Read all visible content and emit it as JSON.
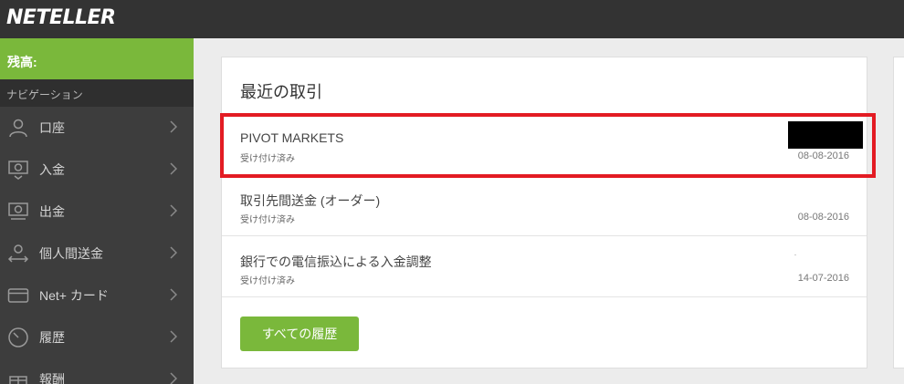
{
  "header": {
    "logo": "NETELLER"
  },
  "sidebar": {
    "balance_label": "残高:",
    "nav_header": "ナビゲーション",
    "items": [
      {
        "label": "口座",
        "icon": "user-icon"
      },
      {
        "label": "入金",
        "icon": "deposit-icon"
      },
      {
        "label": "出金",
        "icon": "withdraw-icon"
      },
      {
        "label": "個人間送金",
        "icon": "transfer-icon"
      },
      {
        "label": "Net+ カード",
        "icon": "card-icon"
      },
      {
        "label": "履歴",
        "icon": "history-icon"
      },
      {
        "label": "報酬",
        "icon": "gift-icon"
      }
    ]
  },
  "recent": {
    "title": "最近の取引",
    "transactions": [
      {
        "name": "PIVOT MARKETS",
        "status": "受け付け済み",
        "date": "08-08-2016"
      },
      {
        "name": "取引先間送金 (オーダー)",
        "status": "受け付け済み",
        "date": "08-08-2016"
      },
      {
        "name": "銀行での電信振込による入金調整",
        "status": "受け付け済み",
        "date": "14-07-2016"
      }
    ],
    "all_history_button": "すべての履歴"
  },
  "colors": {
    "topbar": "#333333",
    "sidebar": "#3d3d3d",
    "accent_green": "#7ab83b",
    "highlight_red": "#e31b23",
    "page_bg": "#ececec"
  }
}
